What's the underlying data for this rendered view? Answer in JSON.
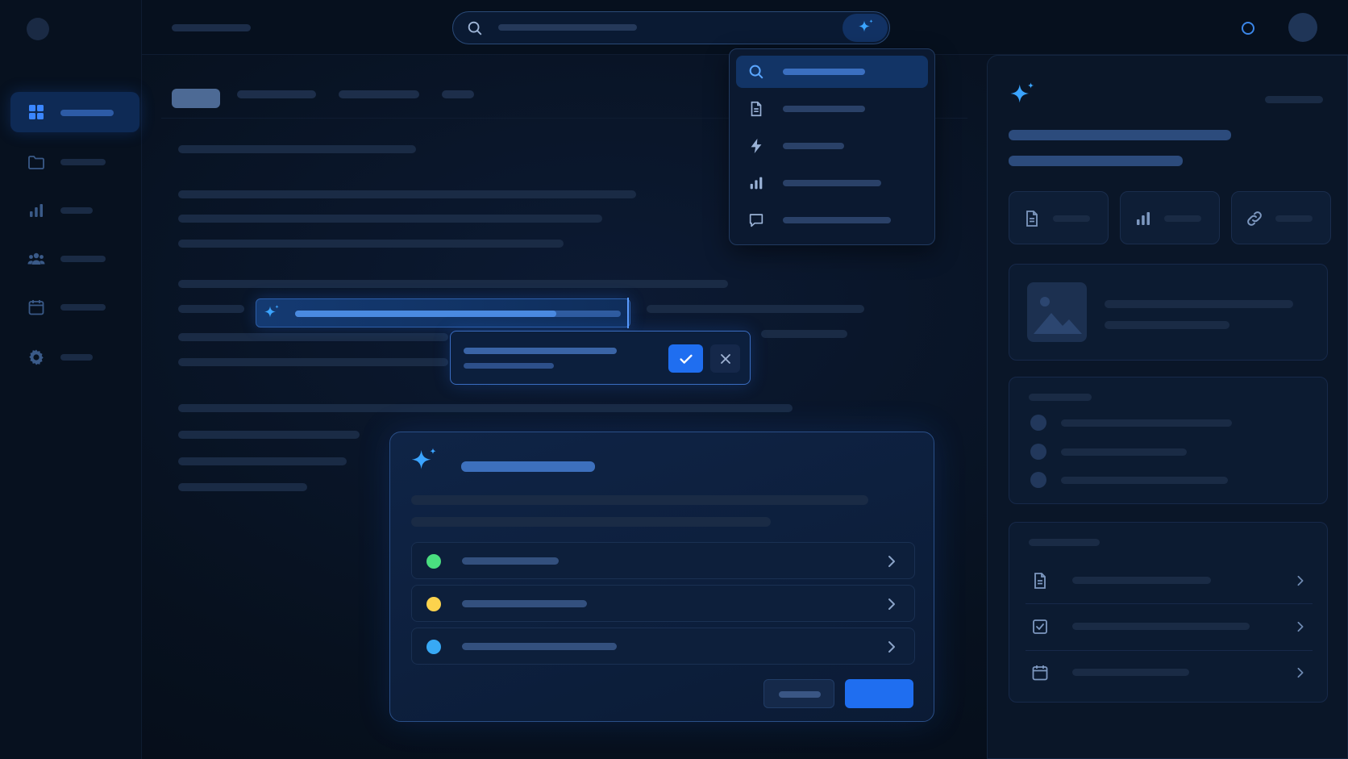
{
  "app": {
    "theme": "dark",
    "accent": "#1f6ef0",
    "ai_accent": "#3b9bff"
  },
  "sidebar": {
    "items": [
      {
        "icon": "grid-icon",
        "active": true
      },
      {
        "icon": "folder-icon",
        "active": false
      },
      {
        "icon": "bar-chart-icon",
        "active": false
      },
      {
        "icon": "users-icon",
        "active": false
      },
      {
        "icon": "calendar-icon",
        "active": false
      },
      {
        "icon": "gear-icon",
        "active": false
      }
    ]
  },
  "search": {
    "icon": "search-icon",
    "ai_icon": "sparkle-icon"
  },
  "dropdown": {
    "items": [
      {
        "icon": "search-icon",
        "active": true
      },
      {
        "icon": "document-icon",
        "active": false
      },
      {
        "icon": "lightning-icon",
        "active": false
      },
      {
        "icon": "bar-chart-icon",
        "active": false
      },
      {
        "icon": "chat-icon",
        "active": false
      }
    ]
  },
  "ai_card": {
    "icon": "sparkle-icon",
    "choices": [
      {
        "status_color": "#4ade80"
      },
      {
        "status_color": "#fcd34d"
      },
      {
        "status_color": "#38a9f5"
      }
    ]
  },
  "right_panel": {
    "icon": "sparkle-icon",
    "chips": [
      {
        "icon": "document-icon"
      },
      {
        "icon": "bar-chart-icon"
      },
      {
        "icon": "link-icon"
      }
    ],
    "list_rows": [
      {
        "icon": "document-icon"
      },
      {
        "icon": "checkbox-icon"
      },
      {
        "icon": "calendar-icon"
      }
    ]
  }
}
